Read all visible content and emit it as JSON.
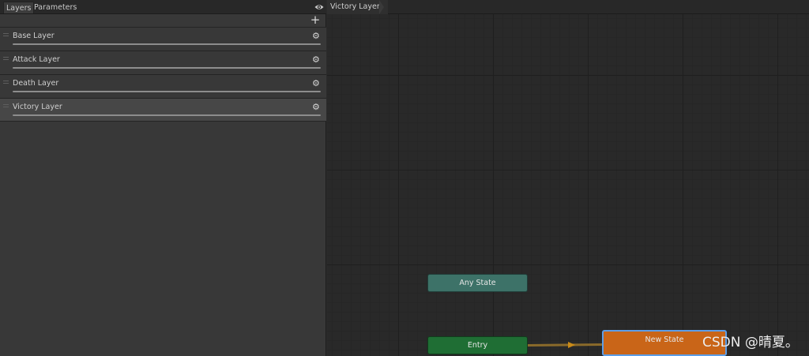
{
  "left_panel": {
    "tabs": [
      {
        "label": "Layers",
        "active": true
      },
      {
        "label": "Parameters",
        "active": false
      }
    ],
    "visibility_icon": "eye-icon",
    "add_icon_glyph": "+",
    "layers": [
      {
        "label": "Base Layer",
        "selected": false,
        "settings_icon": "gear-icon"
      },
      {
        "label": "Attack Layer",
        "selected": false,
        "settings_icon": "gear-icon"
      },
      {
        "label": "Death Layer",
        "selected": false,
        "settings_icon": "gear-icon"
      },
      {
        "label": "Victory Layer",
        "selected": true,
        "settings_icon": "gear-icon"
      }
    ]
  },
  "graph": {
    "breadcrumb": "Victory Layer",
    "states": {
      "any_state": {
        "label": "Any State",
        "color": "#3d7268"
      },
      "entry": {
        "label": "Entry",
        "color": "#1f6e34"
      },
      "new_state": {
        "label": "New State",
        "color": "#c96518",
        "is_default": true
      }
    },
    "transition_color": "#c98a18"
  },
  "watermark": "CSDN @晴夏。"
}
